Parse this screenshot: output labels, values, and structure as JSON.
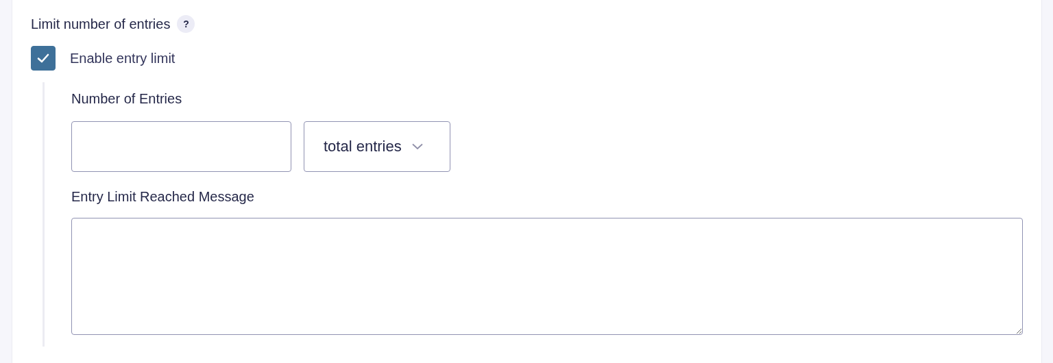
{
  "section": {
    "title": "Limit number of entries",
    "help": "?"
  },
  "enable_checkbox": {
    "label": "Enable entry limit",
    "checked": true
  },
  "number_of_entries": {
    "label": "Number of Entries",
    "period_select": {
      "value": "total entries"
    }
  },
  "limit_message": {
    "label": "Entry Limit Reached Message"
  }
}
